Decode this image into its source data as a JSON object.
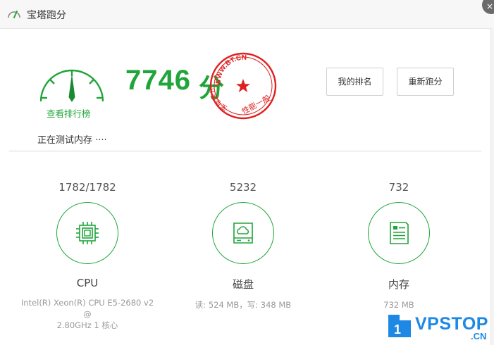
{
  "window": {
    "title": "宝塔跑分",
    "close_glyph": "×"
  },
  "benchmark": {
    "score": "7746",
    "score_unit": "分",
    "rank_link": "查看排行榜",
    "my_rank_button": "我的排名",
    "retest_button": "重新跑分",
    "status": "正在测试内存 ····",
    "stamp": {
      "url_text": "WWW.BT.CN",
      "left_text": "宝塔跑分",
      "bottom_text": "性能一般",
      "color": "#e02020"
    }
  },
  "metrics": [
    {
      "key": "cpu",
      "value": "1782/1782",
      "name": "CPU",
      "desc_line1": "Intel(R) Xeon(R) CPU E5-2680 v2 @",
      "desc_line2": "2.80GHz 1 核心",
      "icon": "cpu-chip-icon"
    },
    {
      "key": "disk",
      "value": "5232",
      "name": "磁盘",
      "desc_line1": "读: 524 MB，写: 348 MB",
      "desc_line2": "",
      "icon": "cloud-disk-icon"
    },
    {
      "key": "memory",
      "value": "732",
      "name": "内存",
      "desc_line1": "732 MB",
      "desc_line2": "",
      "icon": "memory-module-icon"
    }
  ],
  "watermark": {
    "badge_number": "1",
    "brand": "VPSTOP",
    "suffix": ".CN"
  },
  "colors": {
    "accent": "#20a53a",
    "brand_blue": "#1e88e5",
    "stamp_red": "#e02020"
  }
}
